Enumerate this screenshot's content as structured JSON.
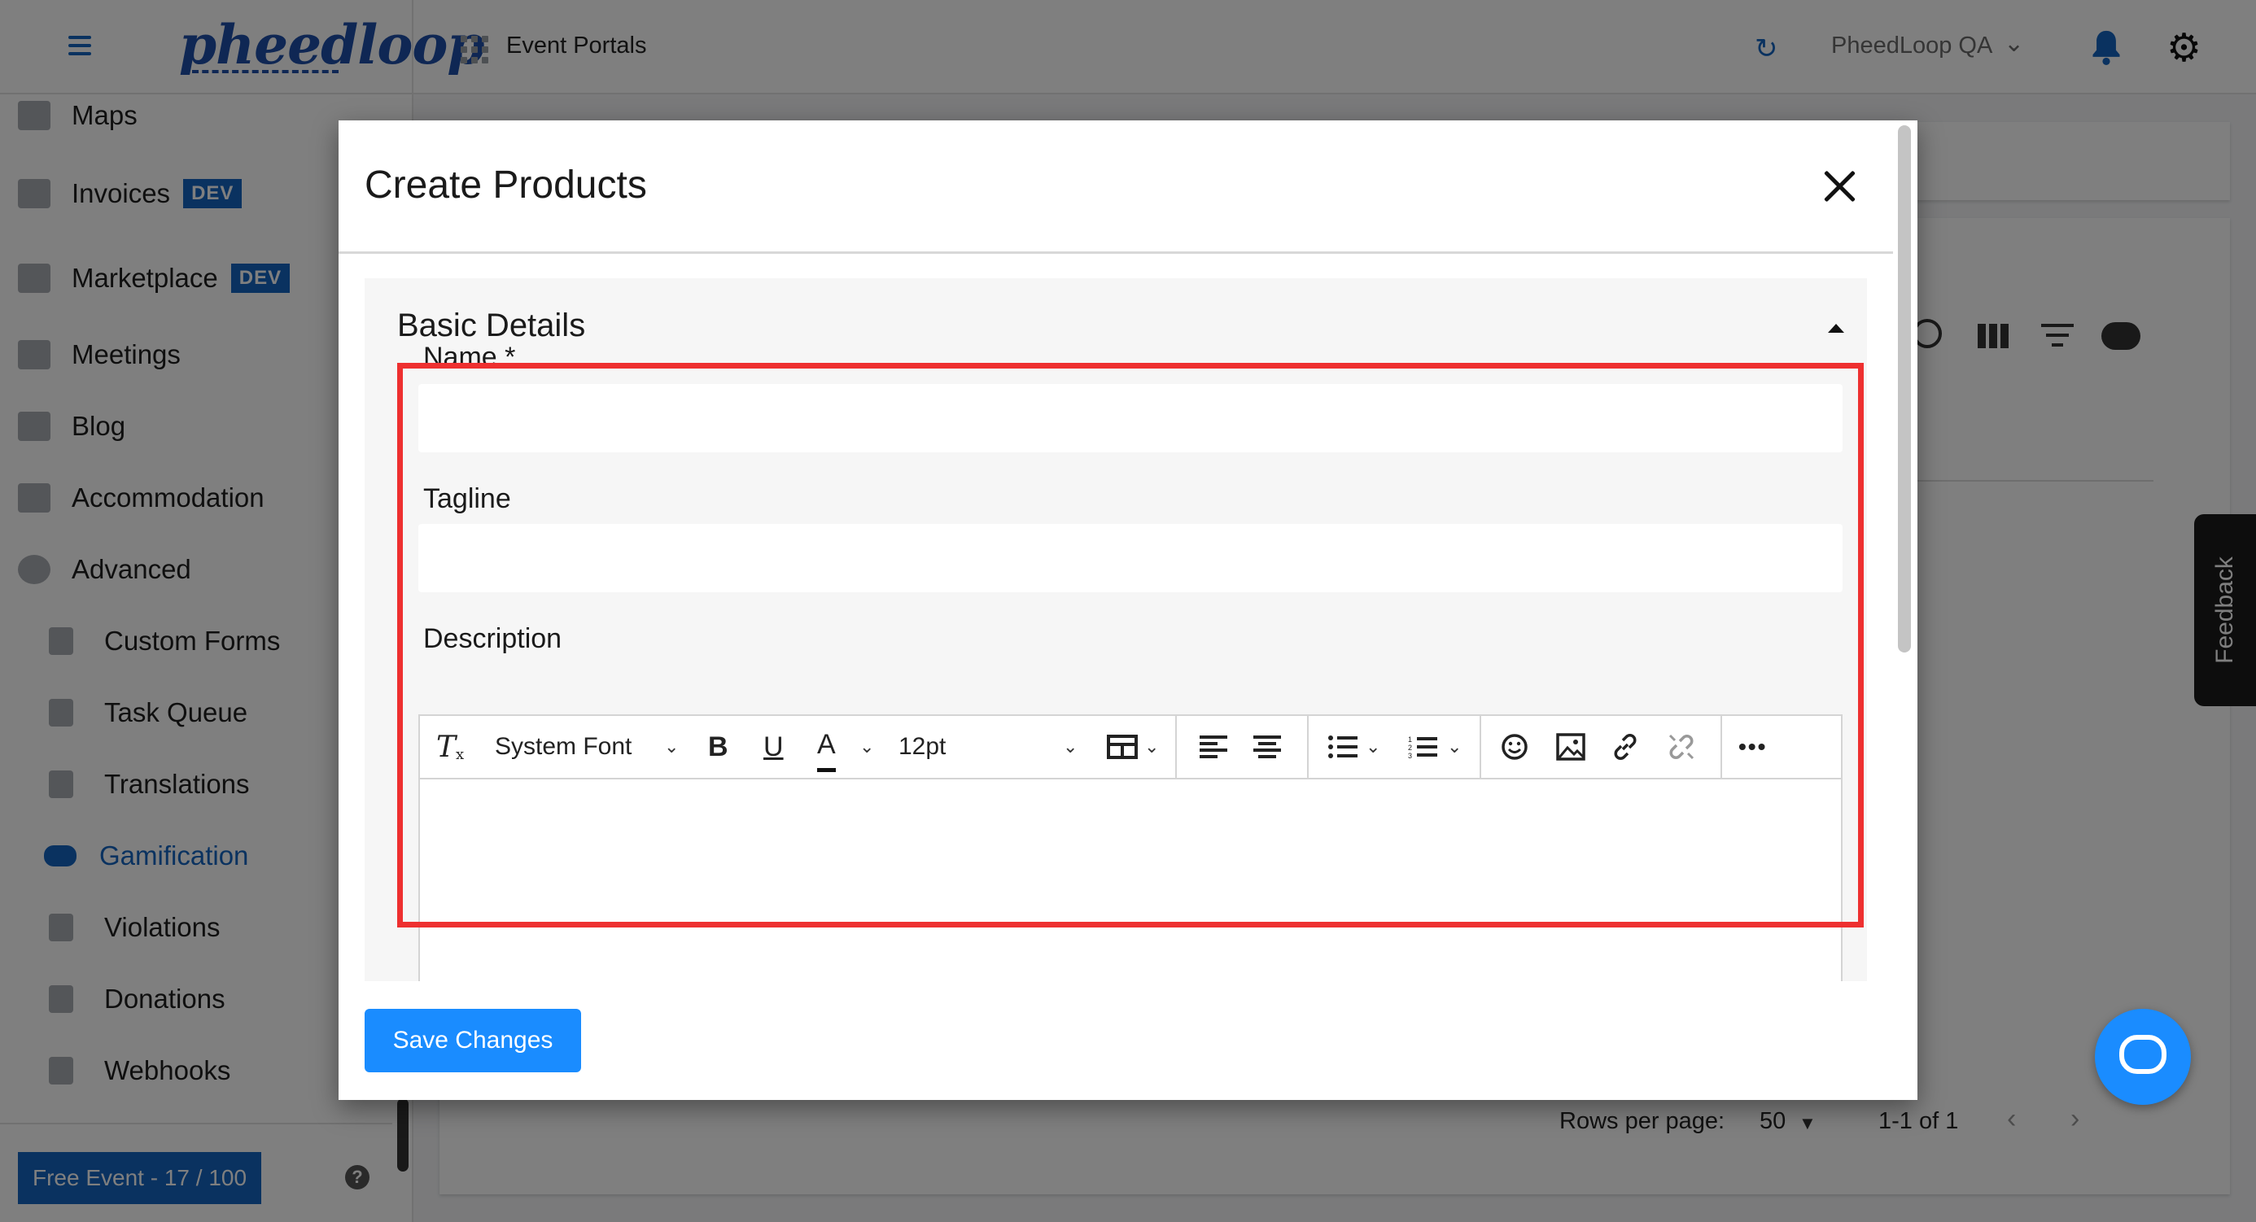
{
  "header": {
    "logo_text": "pheedloop",
    "portal_title": "Event Portals",
    "org_name": "PheedLoop QA"
  },
  "sidebar": {
    "items": [
      {
        "label": "Maps",
        "badge": ""
      },
      {
        "label": "Invoices",
        "badge": "DEV"
      },
      {
        "label": "Marketplace",
        "badge": "DEV"
      },
      {
        "label": "Meetings",
        "badge": ""
      },
      {
        "label": "Blog",
        "badge": ""
      },
      {
        "label": "Accommodation",
        "badge": ""
      },
      {
        "label": "Advanced",
        "badge": ""
      }
    ],
    "sub_items": [
      {
        "label": "Custom Forms"
      },
      {
        "label": "Task Queue"
      },
      {
        "label": "Translations"
      },
      {
        "label": "Gamification",
        "active": true
      },
      {
        "label": "Violations"
      },
      {
        "label": "Donations"
      },
      {
        "label": "Webhooks"
      }
    ],
    "free_event": "Free Event - 17 / 100",
    "help": "?"
  },
  "table_footer": {
    "rows_per_page_label": "Rows per page:",
    "rows_per_page_value": "50",
    "range": "1-1 of 1"
  },
  "feedback_label": "Feedback",
  "modal": {
    "title": "Create Products",
    "section_title": "Basic Details",
    "fields": {
      "name_label": "Name *",
      "name_value": "",
      "tagline_label": "Tagline",
      "tagline_value": "",
      "description_label": "Description"
    },
    "editor_toolbar": {
      "font_family": "System Font",
      "font_size": "12pt",
      "bold": "B",
      "underline": "U",
      "text_color": "A",
      "more": "•••"
    },
    "save_label": "Save Changes"
  },
  "colors": {
    "accent": "#1a8cff",
    "brand": "#1565c0",
    "highlight": "#ee3030"
  }
}
